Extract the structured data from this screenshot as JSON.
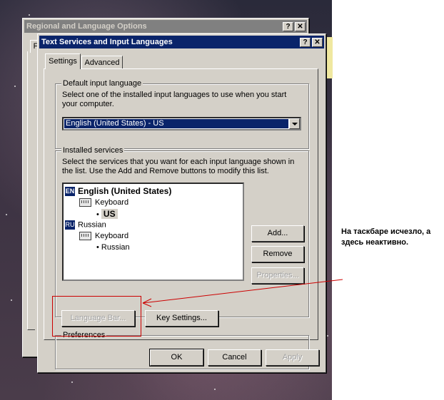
{
  "outer_window": {
    "title": "Regional and Language Options",
    "tab_stub": "F"
  },
  "dialog": {
    "title": "Text Services and Input Languages",
    "help_btn": "?",
    "close_btn": "✕",
    "tabs": [
      "Settings",
      "Advanced"
    ],
    "default_group": {
      "label": "Default input language",
      "desc": "Select one of the installed input languages to use when you start your computer.",
      "selected": "English (United States) - US"
    },
    "installed_group": {
      "label": "Installed services",
      "desc": "Select the services that you want for each input language shown in the list. Use the Add and Remove buttons to modify this list.",
      "items": [
        {
          "badge": "EN",
          "name": "English (United States)",
          "category": "Keyboard",
          "layout": "US"
        },
        {
          "badge": "RU",
          "name": "Russian",
          "category": "Keyboard",
          "layout": "Russian"
        }
      ],
      "add": "Add...",
      "remove": "Remove",
      "properties": "Properties..."
    },
    "prefs_group": {
      "label": "Preferences",
      "language_bar": "Language Bar...",
      "key_settings": "Key Settings..."
    },
    "ok": "OK",
    "cancel": "Cancel",
    "apply": "Apply"
  },
  "annotation": {
    "text": "На таскбаре исчезло, а здесь неактивно.",
    "color": "#cc0000"
  }
}
